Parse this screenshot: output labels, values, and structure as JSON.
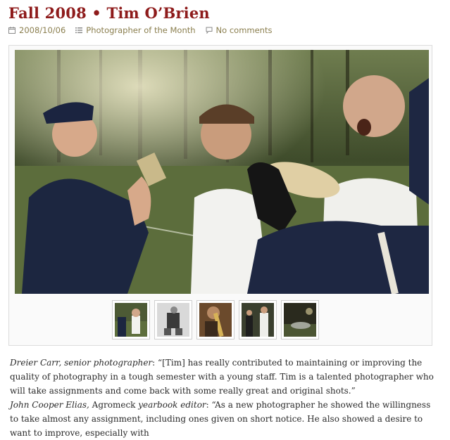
{
  "post": {
    "title": "Fall 2008 • Tim O’Brien",
    "date": "2008/10/06",
    "category": "Photographer of the Month",
    "comments": "No comments"
  },
  "icons": {
    "date": "calendar-icon",
    "category": "list-icon",
    "comments": "speech-bubble-icon"
  },
  "gallery": {
    "thumbnail_count": 5
  },
  "quotes": [
    {
      "speaker": "Dreier Carr, senior photographer",
      "text": ": “[Tim] has really contributed to maintaining or improving the quality of photography in a tough semester with a young staff. Tim is a talented photographer who will take assignments and come back with some really great and original shots.”"
    },
    {
      "speaker_name": "John Cooper Elias,",
      "speaker_mid": " Agromeck ",
      "speaker_role": "yearbook editor",
      "text": ": “As a new photographer he showed the willingness to take almost any assignment, including ones given on short notice. He also showed a desire to want to improve, especially with"
    }
  ],
  "colors": {
    "title": "#8e1b1b",
    "meta_link": "#8a7e4e"
  }
}
